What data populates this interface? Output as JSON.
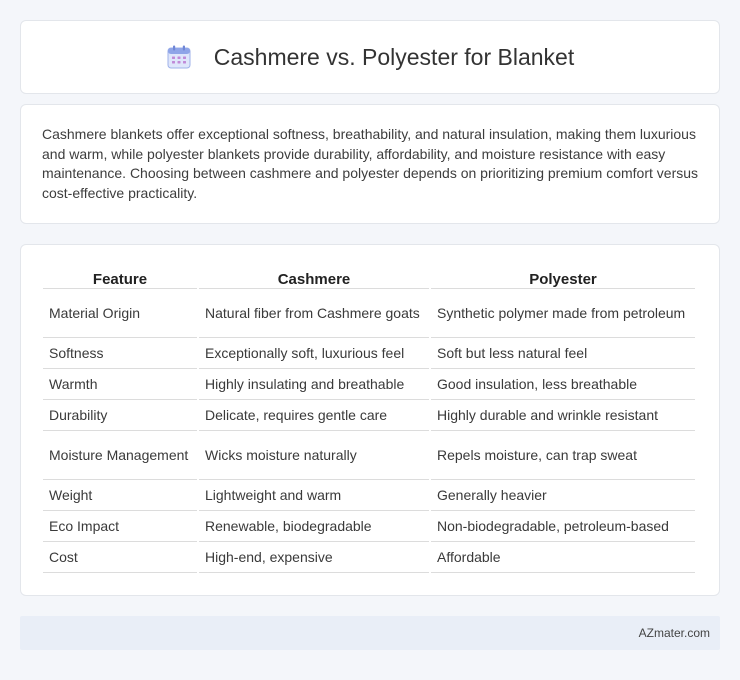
{
  "header": {
    "title": "Cashmere vs. Polyester for Blanket",
    "icon": "calendar-icon"
  },
  "intro": {
    "text": "Cashmere blankets offer exceptional softness, breathability, and natural insulation, making them luxurious and warm, while polyester blankets provide durability, affordability, and moisture resistance with easy maintenance. Choosing between cashmere and polyester depends on prioritizing premium comfort versus cost-effective practicality."
  },
  "table": {
    "headers": [
      "Feature",
      "Cashmere",
      "Polyester"
    ],
    "rows": [
      [
        "Material Origin",
        "Natural fiber from Cashmere goats",
        "Synthetic polymer made from petroleum"
      ],
      [
        "Softness",
        "Exceptionally soft, luxurious feel",
        "Soft but less natural feel"
      ],
      [
        "Warmth",
        "Highly insulating and breathable",
        "Good insulation, less breathable"
      ],
      [
        "Durability",
        "Delicate, requires gentle care",
        "Highly durable and wrinkle resistant"
      ],
      [
        "Moisture Management",
        "Wicks moisture naturally",
        "Repels moisture, can trap sweat"
      ],
      [
        "Weight",
        "Lightweight and warm",
        "Generally heavier"
      ],
      [
        "Eco Impact",
        "Renewable, biodegradable",
        "Non-biodegradable, petroleum-based"
      ],
      [
        "Cost",
        "High-end, expensive",
        "Affordable"
      ]
    ]
  },
  "footer": {
    "brand": "AZmater.com"
  }
}
